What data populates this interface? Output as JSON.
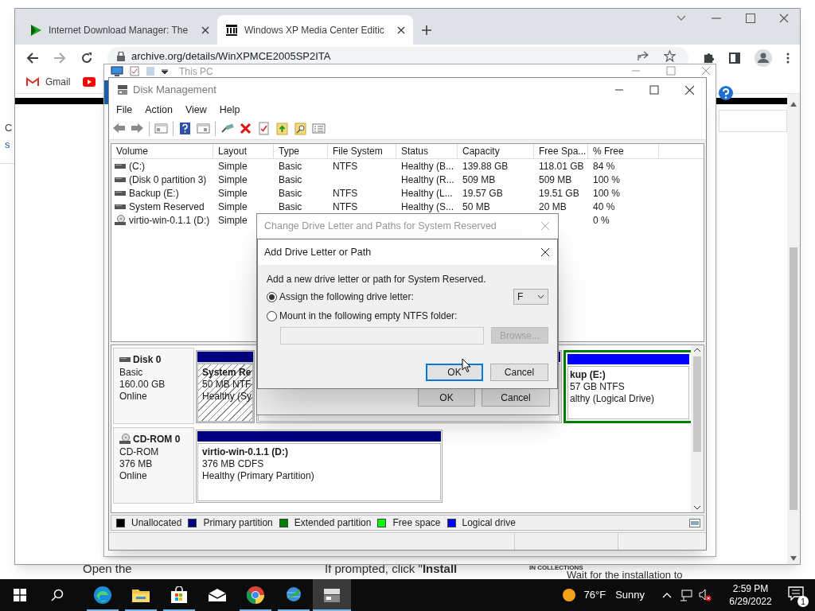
{
  "background": {
    "side_text": [
      "C",
      "s"
    ],
    "bottom_text": [
      "Open the",
      "If prompted, click \"**Install**",
      "IN COLLECTIONS",
      "Wait for the installation to"
    ]
  },
  "browser": {
    "tabs": [
      {
        "title": "Internet Download Manager: The",
        "kind": "idm",
        "selected": false
      },
      {
        "title": "Windows XP Media Center Editic",
        "kind": "archive",
        "selected": true
      }
    ],
    "address": "archive.org/details/WinXPMCE2005SP2ITA",
    "bookmarks": [
      {
        "label": "Gmail",
        "kind": "gmail"
      },
      {
        "kind": "youtube"
      }
    ]
  },
  "explorer": {
    "title": "This PC"
  },
  "disk_management": {
    "title": "Disk Management",
    "menu": [
      "File",
      "Action",
      "View",
      "Help"
    ],
    "columns": [
      "Volume",
      "Layout",
      "Type",
      "File System",
      "Status",
      "Capacity",
      "Free Spa...",
      "% Free"
    ],
    "volumes": [
      {
        "kind": "disk",
        "volume": "(C:)",
        "layout": "Simple",
        "type": "Basic",
        "file_system": "NTFS",
        "status": "Healthy (B...",
        "capacity": "139.88 GB",
        "free_space": "118.01 GB",
        "percent_free": "84 %"
      },
      {
        "kind": "disk",
        "volume": "(Disk 0 partition 3)",
        "layout": "Simple",
        "type": "Basic",
        "status": "Healthy (R...",
        "capacity": "509 MB",
        "free_space": "509 MB",
        "percent_free": "100 %"
      },
      {
        "kind": "disk",
        "volume": "Backup (E:)",
        "layout": "Simple",
        "type": "Basic",
        "file_system": "NTFS",
        "status": "Healthy (L...",
        "capacity": "19.57 GB",
        "free_space": "19.51 GB",
        "percent_free": "100 %"
      },
      {
        "kind": "disk",
        "volume": "System Reserved",
        "layout": "Simple",
        "type": "Basic",
        "file_system": "NTFS",
        "status": "Healthy (S...",
        "capacity": "50 MB",
        "free_space": "20 MB",
        "percent_free": "40 %"
      },
      {
        "kind": "cdrom",
        "volume": "virtio-win-0.1.1 (D:)",
        "layout": "Simple",
        "percent_free": "0 %"
      }
    ],
    "disks": [
      {
        "kind": "disk",
        "name": "Disk 0",
        "lines": [
          "Basic",
          "160.00 GB",
          "Online"
        ],
        "partitions": [
          {
            "kind": "primary",
            "selected": true,
            "title": "System Re",
            "lines": [
              "50 MB NTF",
              "Healthy (Sy"
            ]
          },
          {
            "kind": "primary",
            "selected": false
          },
          {
            "kind": "logical",
            "selected": false,
            "title": "kup  (E:)",
            "lines": [
              "57 GB NTFS",
              "althy (Logical Drive)"
            ]
          }
        ]
      },
      {
        "kind": "cdrom",
        "name": "CD-ROM 0",
        "lines": [
          "CD-ROM",
          "376 MB",
          "Online"
        ],
        "partitions": [
          {
            "kind": "primary",
            "selected": false,
            "title": "virtio-win-0.1.1  (D:)",
            "lines": [
              "376 MB CDFS",
              "Healthy (Primary Partition)"
            ]
          }
        ]
      }
    ],
    "legend": [
      {
        "label": "Unallocated",
        "color": "#000000"
      },
      {
        "label": "Primary partition",
        "color": "#000080"
      },
      {
        "label": "Extended partition",
        "color": "#008000"
      },
      {
        "label": "Free space",
        "color": "#00ff00"
      },
      {
        "label": "Logical drive",
        "color": "#0000ff"
      }
    ]
  },
  "change_dialog": {
    "title": "Change Drive Letter and Paths for System Reserved",
    "buttons": [
      "OK",
      "Cancel"
    ]
  },
  "add_dialog": {
    "title": "Add Drive Letter or Path",
    "prompt": "Add a new drive letter or path for System Reserved.",
    "options": [
      {
        "label": "Assign the following drive letter:",
        "selected": true
      },
      {
        "label": "Mount in the following empty NTFS folder:",
        "selected": false
      }
    ],
    "drive_letter": "F",
    "path_field": {
      "disabled": true
    },
    "browse": {
      "label": "Browse...",
      "disabled": true
    },
    "buttons": [
      {
        "label": "OK",
        "focused": true
      },
      {
        "label": "Cancel",
        "focused": false
      }
    ]
  },
  "taskbar": {
    "apps": [
      {
        "kind": "edge",
        "running": true,
        "active": false
      },
      {
        "kind": "folder",
        "running": true,
        "active": false
      },
      {
        "kind": "store",
        "running": true,
        "active": false
      },
      {
        "kind": "mail",
        "running": false,
        "active": false
      },
      {
        "kind": "chrome",
        "running": true,
        "active": false
      },
      {
        "kind": "idm",
        "running": true,
        "active": false
      },
      {
        "kind": "diskmgmt",
        "running": true,
        "active": true
      }
    ],
    "weather": {
      "temperature": "76°F",
      "condition": "Sunny"
    },
    "time": "2:59 PM",
    "date": "6/29/2022",
    "notifications": "1"
  }
}
